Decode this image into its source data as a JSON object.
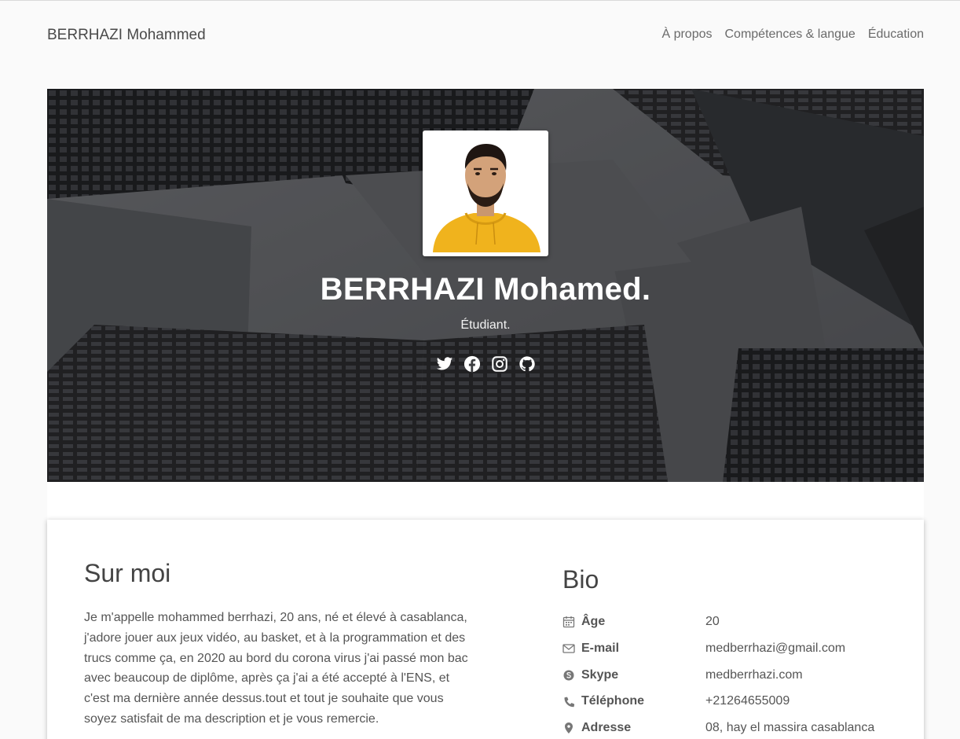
{
  "navbar": {
    "brand": "BERRHAZI Mohammed",
    "links": [
      "À propos",
      "Compétences & langue",
      "Éducation"
    ]
  },
  "hero": {
    "name": "BERRHAZI Mohamed.",
    "role": "Étudiant.",
    "socials": [
      "twitter-icon",
      "facebook-icon",
      "instagram-icon",
      "github-icon"
    ]
  },
  "about": {
    "title": "Sur moi",
    "text": "Je m'appelle mohammed berrhazi, 20 ans, né et élevé à casablanca, j'adore jouer aux jeux vidéo, au basket, et à la programmation et des trucs comme ça, en 2020 au bord du corona virus j'ai passé mon bac avec beaucoup de diplôme, après ça j'ai a été accepté à l'ENS, et c'est ma dernière année dessus.tout et tout je souhaite que vous soyez satisfait de ma description et je vous remercie."
  },
  "bio": {
    "title": "Bio",
    "rows": [
      {
        "icon": "calendar-icon",
        "label": "Âge",
        "value": "20"
      },
      {
        "icon": "envelope-icon",
        "label": "E-mail",
        "value": "medberrhazi@gmail.com"
      },
      {
        "icon": "skype-icon",
        "label": "Skype",
        "value": "medberrhazi.com"
      },
      {
        "icon": "phone-icon",
        "label": "Téléphone",
        "value": "+21264655009"
      },
      {
        "icon": "map-marker-icon",
        "label": "Adresse",
        "value": "08, hay el massira casablanca"
      }
    ]
  },
  "colors": {
    "page_bg": "#fafafa",
    "hero_overlay": "#141416",
    "hoodie": "#f0b31d",
    "text": "#555555"
  }
}
